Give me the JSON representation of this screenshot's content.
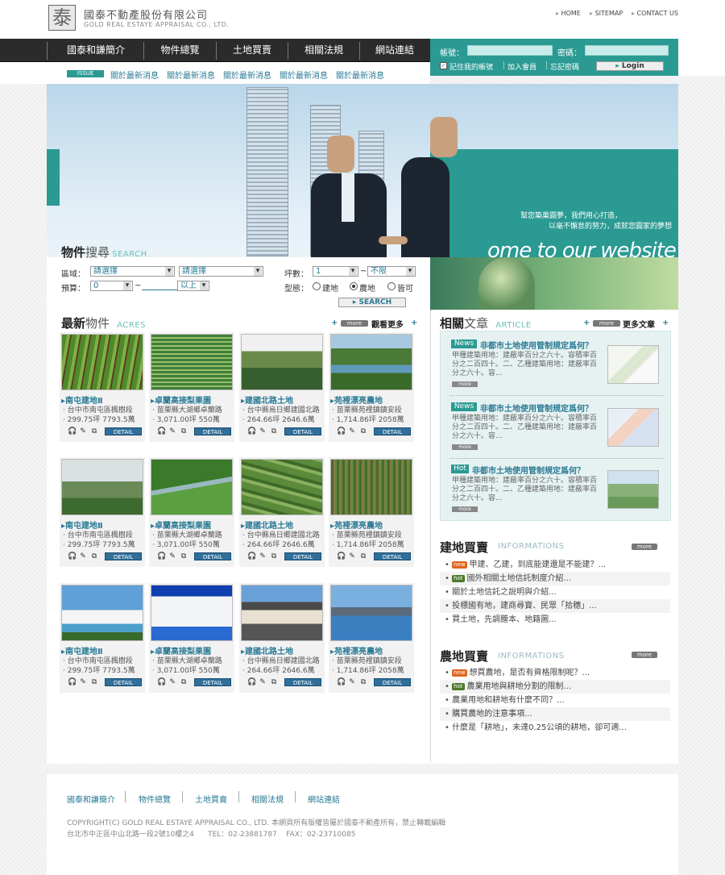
{
  "header": {
    "logo_char": "泰",
    "company_name": "國泰不動產股份有限公司",
    "company_en": "GOLD REAL ESTAYE APPRAISAL CO., LTD.",
    "links": [
      "HOME",
      "SITEMAP",
      "CONTACT US"
    ]
  },
  "nav": {
    "items": [
      "國泰和謙簡介",
      "物件總覽",
      "土地買賣",
      "相關法規",
      "網站連結"
    ]
  },
  "login": {
    "account_label": "帳號：",
    "password_label": "密碼：",
    "remember_label": "記住我的帳號",
    "join_label": "加入會員",
    "forgot_label": "忘記密碼",
    "button_label": "Login"
  },
  "issue": {
    "badge": "ISSUE",
    "items": [
      "關於最新消息",
      "關於最新消息",
      "關於最新消息",
      "關於最新消息",
      "關於最新消息"
    ]
  },
  "hero": {
    "slogan1": "幫您築巢圓夢，我們用心打造，",
    "slogan2": "以毫不懈怠的努力，成就您圓家的夢想",
    "welcome": "ome to our website"
  },
  "search": {
    "title_bold": "物件",
    "title_normal": "搜尋",
    "subtitle": "SEARCH",
    "region_label": "區域：",
    "region1": "請選擇",
    "region2": "請選擇",
    "budget_label": "預算：",
    "budget_from": "0",
    "budget_to": "以上",
    "size_label": "坪數：",
    "size_from": "1",
    "size_to": "不限",
    "type_label": "型態：",
    "types": [
      "建地",
      "農地",
      "皆可"
    ],
    "button_label": "SEARCH"
  },
  "latest": {
    "title_bold": "最新",
    "title_normal": "物件",
    "subtitle": "ACRES",
    "more_badge": "more",
    "more_label": "觀看更多",
    "detail_label": "DETAIL",
    "cards": [
      {
        "name": "南屯建地Ⅱ",
        "line1": "台中市南屯區楓樹段",
        "line2": "299.75坪  7793.5萬"
      },
      {
        "name": "卓蘭高接梨果園",
        "line1": "苗栗縣大湖鄉卓蘭路",
        "line2": "3,071.00坪  550萬"
      },
      {
        "name": "建國北路土地",
        "line1": "台中縣烏日鄉建國北路",
        "line2": "264.66坪  2646.6萬"
      },
      {
        "name": "苑裡漂亮農地",
        "line1": "苗栗縣苑裡鎮鎮安段",
        "line2": "1,714.86坪  2058萬"
      }
    ]
  },
  "article": {
    "title_bold": "相關",
    "title_normal": "文章",
    "subtitle": "ARTICLE",
    "more_badge": "more",
    "more_label": "更多文章",
    "items": [
      {
        "badge": "News",
        "title": "非都市土地使用管制規定爲何？",
        "text": "甲種建築用地：建蔽率百分之六十。容積率百分之二百四十。二、乙種建築用地：建蔽率百分之六十。容...",
        "more": "more"
      },
      {
        "badge": "News",
        "title": "非都市土地使用管制規定爲何？",
        "text": "甲種建築用地：建蔽率百分之六十。容積率百分之二百四十。二、乙種建築用地：建蔽率百分之六十。容...",
        "more": "more"
      },
      {
        "badge": "Hot",
        "title": "非都市土地使用管制規定爲何？",
        "text": "甲種建築用地：建蔽率百分之六十。容積率百分之二百四十。二、乙種建築用地：建蔽率百分之六十。容...",
        "more": "more"
      }
    ]
  },
  "building_land": {
    "title": "建地買賣",
    "subtitle": "INFORMATIONS",
    "more_badge": "more",
    "items": [
      {
        "tag": "new",
        "text": "甲建、乙建，到底能建還是不能建？..."
      },
      {
        "tag": "hot",
        "text": "國外相關土地信託制度介紹..."
      },
      {
        "tag": "",
        "text": "關於土地信託之說明與介紹..."
      },
      {
        "tag": "",
        "text": "投標國有地，建商尋寶、民眾「拾穗」..."
      },
      {
        "tag": "",
        "text": "買土地，先調謄本、地籍圖..."
      }
    ]
  },
  "farm_land": {
    "title": "農地買賣",
    "subtitle": "INFORMATIONS",
    "more_badge": "more",
    "items": [
      {
        "tag": "new",
        "text": "想買農地，是否有資格限制呢？..."
      },
      {
        "tag": "hot",
        "text": "農業用地與耕地分割的限制..."
      },
      {
        "tag": "",
        "text": "農業用地和耕地有什麼不同？..."
      },
      {
        "tag": "",
        "text": "購買農地的注意事項..."
      },
      {
        "tag": "",
        "text": "什麼是「耕地」，未達0.25公頃的耕地，卻可適..."
      }
    ]
  },
  "footer": {
    "links": [
      "國泰和謙簡介",
      "物件總覽",
      "土地買賣",
      "相關法規",
      "網站連結"
    ],
    "copyright": "COPYRIGHT(C) GOLD REAL ESTAYE APPRAISAL CO., LTD. 本網頁所有版權皆屬於國泰不動產所有，禁止轉載編輯",
    "address": "台北市中正區中山北路一段2號10樓之4      TEL：02-23881787    FAX：02-23710085"
  },
  "colors": {
    "accent": "#2a9a93",
    "nav_bg": "#2b2b2b",
    "link": "#2a7a95",
    "detail": "#2f6f9a",
    "new_tag": "#e0661e",
    "hot_tag": "#4a7a2a"
  }
}
